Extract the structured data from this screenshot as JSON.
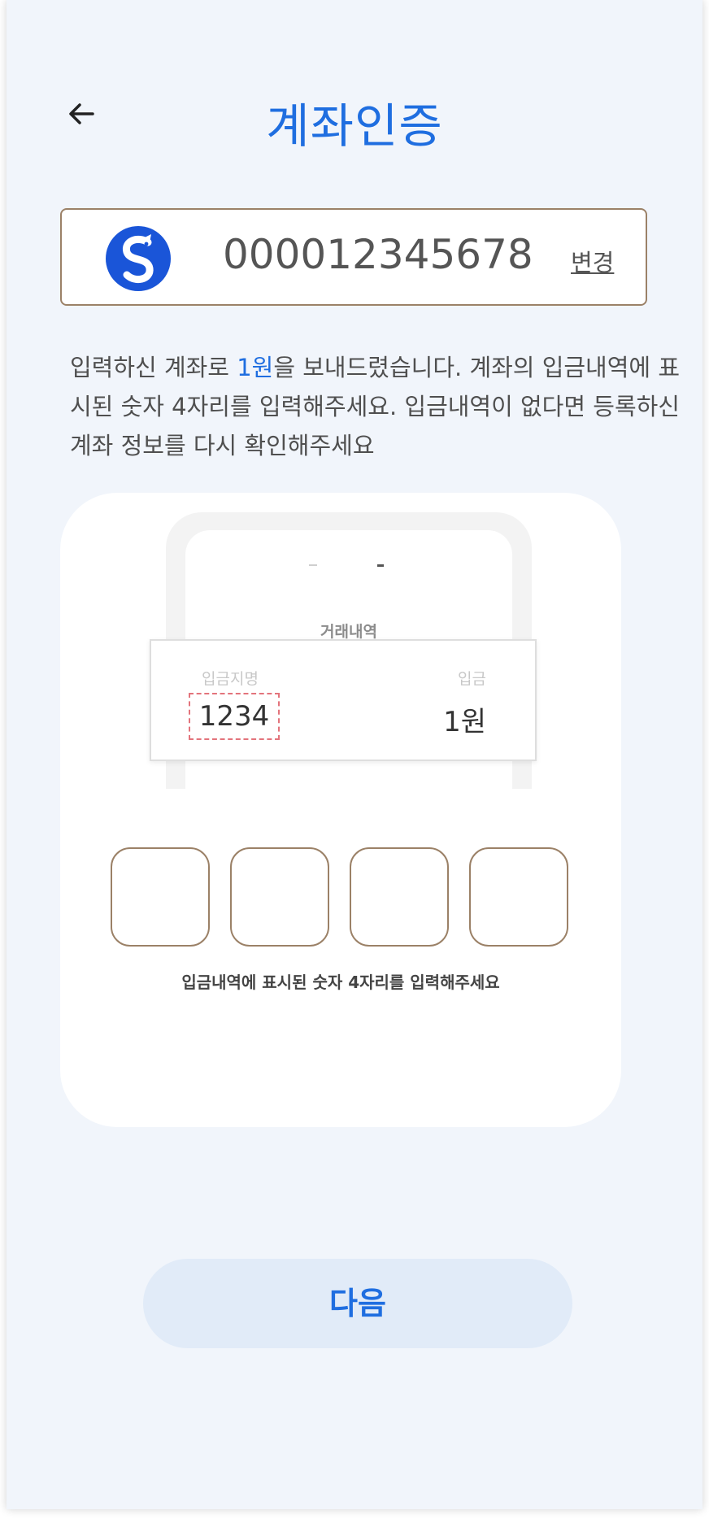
{
  "header": {
    "title": "계좌인증"
  },
  "account": {
    "number": "000012345678",
    "change_label": "변경",
    "bank_color": "#1a55d8"
  },
  "guide": {
    "part1": "입력하신 계좌로 ",
    "highlight": "1원",
    "part2": "을 보내드렸습니다. 계좌의 입금내역에 표시된 숫자 4자리를 입력해주세요. 입금내역이 없다면 등록하신 계좌 정보를 다시 확인해주세요"
  },
  "illustration": {
    "screen_title": "거래내역",
    "depositor_label": "입금지명",
    "deposit_label": "입금",
    "code_example": "1234",
    "amount": "1원"
  },
  "code_entry": {
    "hint": "입금내역에 표시된 숫자 4자리를 입력해주세요",
    "digits": [
      "",
      "",
      "",
      ""
    ]
  },
  "footer": {
    "next_label": "다음"
  },
  "colors": {
    "accent": "#1f6ee0",
    "border": "#9b8167",
    "background": "#f1f5fb"
  }
}
